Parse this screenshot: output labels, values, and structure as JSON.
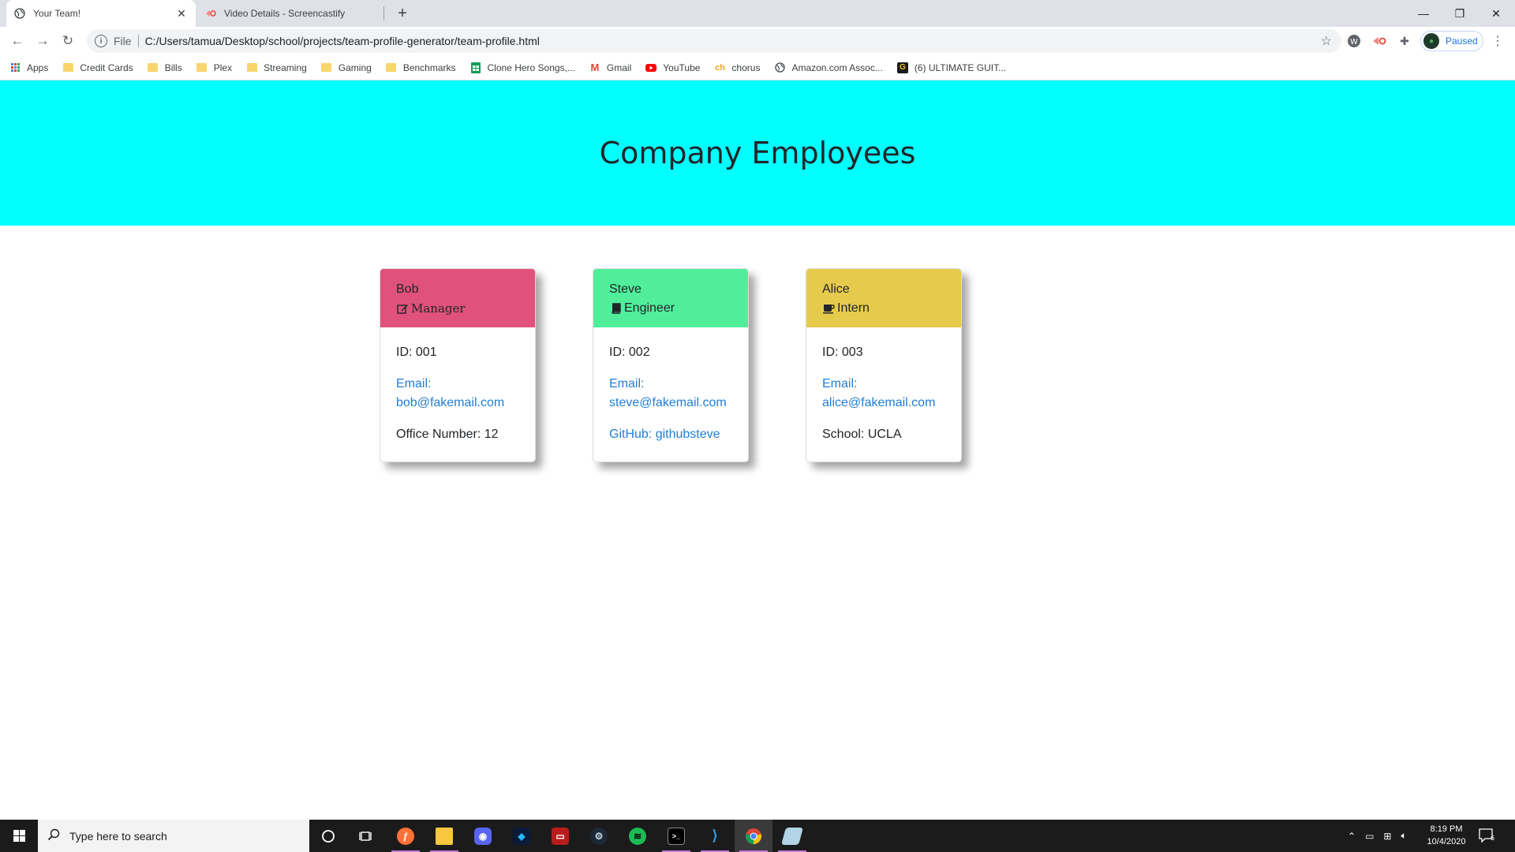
{
  "browser": {
    "tabs": [
      {
        "title": "Your Team!",
        "active": true,
        "icon": "globe-icon"
      },
      {
        "title": "Video Details - Screencastify",
        "active": false,
        "icon": "screencastify-icon"
      }
    ],
    "address": {
      "scheme_label": "File",
      "url": "C:/Users/tamua/Desktop/school/projects/team-profile-generator/team-profile.html"
    },
    "profile_label": "Paused",
    "bookmarks": [
      {
        "label": "Apps",
        "icon": "apps-grid-icon"
      },
      {
        "label": "Credit Cards",
        "icon": "folder-icon"
      },
      {
        "label": "Bills",
        "icon": "folder-icon"
      },
      {
        "label": "Plex",
        "icon": "folder-icon"
      },
      {
        "label": "Streaming",
        "icon": "folder-icon"
      },
      {
        "label": "Gaming",
        "icon": "folder-icon"
      },
      {
        "label": "Benchmarks",
        "icon": "folder-icon"
      },
      {
        "label": "Clone Hero Songs,...",
        "icon": "sheets-icon"
      },
      {
        "label": "Gmail",
        "icon": "gmail-icon"
      },
      {
        "label": "YouTube",
        "icon": "youtube-icon"
      },
      {
        "label": "chorus",
        "icon": "chorus-icon"
      },
      {
        "label": "Amazon.com Assoc...",
        "icon": "globe-icon"
      },
      {
        "label": "(6) ULTIMATE GUIT...",
        "icon": "ultimate-guitar-icon"
      }
    ]
  },
  "page": {
    "heading": "Company Employees",
    "cards": [
      {
        "name": "Bob",
        "role": "Manager",
        "role_icon": "edit-icon",
        "header_color": "#e0527c",
        "id_text": "ID: 001",
        "email_label": "Email:",
        "email": "bob@fakemail.com",
        "extra": "Office Number: 12",
        "extra_is_link": false
      },
      {
        "name": "Steve",
        "role": "Engineer",
        "role_icon": "book-icon",
        "header_color": "#50ee9b",
        "id_text": "ID: 002",
        "email_label": "Email:",
        "email": "steve@fakemail.com",
        "extra": "GitHub: githubsteve",
        "extra_is_link": true
      },
      {
        "name": "Alice",
        "role": "Intern",
        "role_icon": "coffee-icon",
        "header_color": "#e6ca4c",
        "id_text": "ID: 003",
        "email_label": "Email:",
        "email": "alice@fakemail.com",
        "extra": "School: UCLA",
        "extra_is_link": false
      }
    ]
  },
  "taskbar": {
    "search_placeholder": "Type here to search",
    "time": "8:19 PM",
    "date": "10/4/2020",
    "notification_count": "6",
    "apps": [
      "firefox-icon",
      "file-explorer-icon",
      "discord-icon",
      "dev-tool-icon",
      "game-launcher-icon",
      "steam-icon",
      "spotify-icon",
      "terminal-icon",
      "vscode-icon",
      "chrome-icon",
      "notes-icon"
    ]
  }
}
